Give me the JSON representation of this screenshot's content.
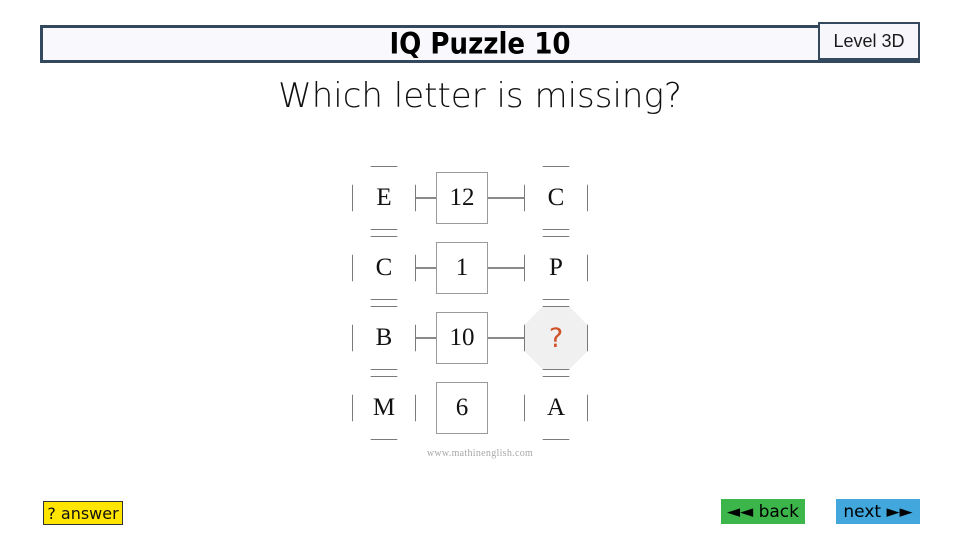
{
  "header": {
    "title": "IQ Puzzle 10",
    "level_label": "Level 3D"
  },
  "question": "Which letter is missing?",
  "puzzle": {
    "rows": [
      {
        "left": "E",
        "middle": "12",
        "right": "C",
        "connected": true,
        "unknown": false
      },
      {
        "left": "C",
        "middle": "1",
        "right": "P",
        "connected": true,
        "unknown": false
      },
      {
        "left": "B",
        "middle": "10",
        "right": "?",
        "connected": true,
        "unknown": true
      },
      {
        "left": "M",
        "middle": "6",
        "right": "A",
        "connected": false,
        "unknown": false
      }
    ],
    "unknown_color": "#cf5229"
  },
  "watermark": "www.mathinenglish.com",
  "footer": {
    "answer_label": "? answer",
    "back_label": "◄◄ back",
    "next_label": "next ►►",
    "answer_color": "#ffe500",
    "back_color": "#3cb54a",
    "next_color": "#41a7dc"
  }
}
